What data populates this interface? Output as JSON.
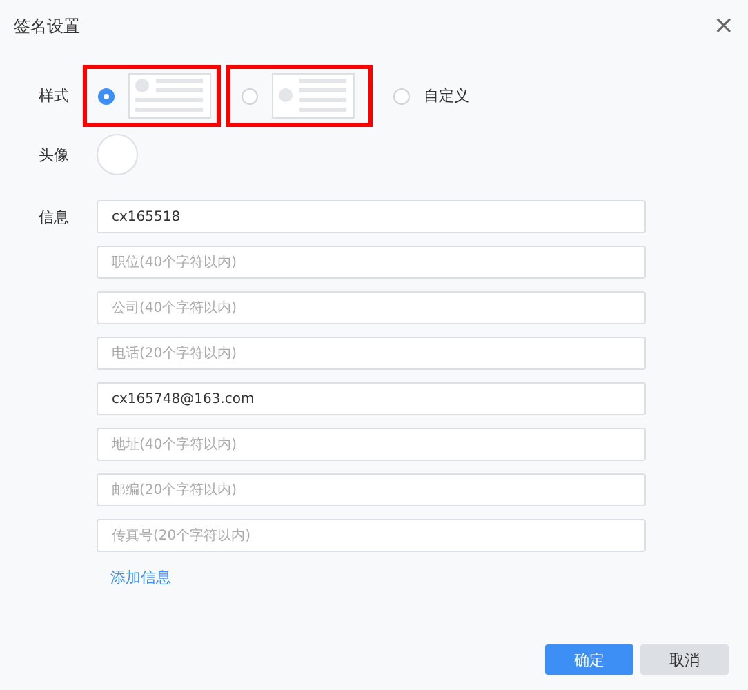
{
  "window": {
    "title": "签名设置",
    "close": "×"
  },
  "style": {
    "label": "样式",
    "options": [
      {
        "kind": "preview",
        "avatar_inline": false,
        "selected": true,
        "annotated": true
      },
      {
        "kind": "preview",
        "avatar_inline": true,
        "selected": false,
        "annotated": true
      },
      {
        "kind": "text",
        "label": "自定义",
        "selected": false,
        "annotated": false
      }
    ]
  },
  "avatar": {
    "label": "头像"
  },
  "info": {
    "label": "信息",
    "fields": [
      {
        "value": "cx165518"
      },
      {
        "placeholder": "职位(40个字符以内)"
      },
      {
        "placeholder": "公司(40个字符以内)"
      },
      {
        "placeholder": "电话(20个字符以内)"
      },
      {
        "value": "cx165748@163.com"
      },
      {
        "placeholder": "地址(40个字符以内)"
      },
      {
        "placeholder": "邮编(20个字符以内)"
      },
      {
        "placeholder": "传真号(20个字符以内)"
      }
    ],
    "add_link": "添加信息"
  },
  "buttons": [
    {
      "label": "确定",
      "kind": "primary"
    },
    {
      "label": "取消",
      "kind": "secondary"
    }
  ]
}
